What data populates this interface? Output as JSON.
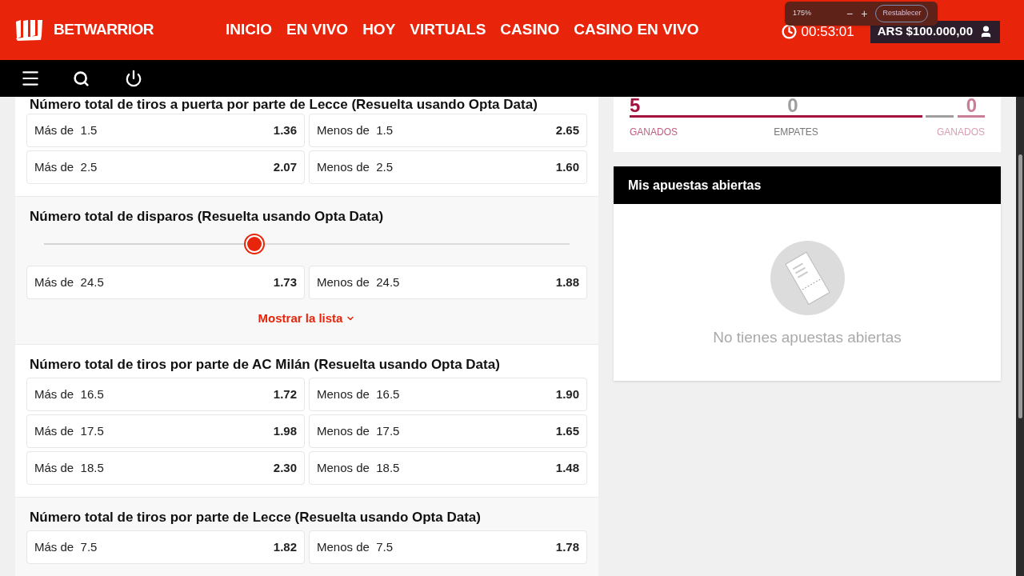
{
  "header": {
    "logo": "BETWARRIOR",
    "nav": [
      "INICIO",
      "EN VIVO",
      "HOY",
      "VIRTUALS",
      "CASINO",
      "CASINO EN VIVO"
    ],
    "timer": "00:53:01",
    "balance": "ARS $100.000,00"
  },
  "zoom_popup": {
    "level": "175%",
    "minus": "−",
    "plus": "+",
    "reset": "Restablecer"
  },
  "markets": [
    {
      "title": "Número total de tiros a puerta por parte de Lecce (Resuelta usando Opta Data)",
      "rows": [
        [
          {
            "label": "Más de",
            "line": "1.5",
            "odd": "1.36"
          },
          {
            "label": "Menos de",
            "line": "1.5",
            "odd": "2.65"
          }
        ],
        [
          {
            "label": "Más de",
            "line": "2.5",
            "odd": "2.07"
          },
          {
            "label": "Menos de",
            "line": "2.5",
            "odd": "1.60"
          }
        ]
      ]
    },
    {
      "title": "Número total de disparos (Resuelta usando Opta Data)",
      "slider": {
        "level": 0.4
      },
      "rows": [
        [
          {
            "label": "Más de",
            "line": "24.5",
            "odd": "1.73"
          },
          {
            "label": "Menos de",
            "line": "24.5",
            "odd": "1.88"
          }
        ]
      ],
      "show_more": "Mostrar la lista"
    },
    {
      "title": "Número total de tiros por parte de AC Milán (Resuelta usando Opta Data)",
      "rows": [
        [
          {
            "label": "Más de",
            "line": "16.5",
            "odd": "1.72"
          },
          {
            "label": "Menos de",
            "line": "16.5",
            "odd": "1.90"
          }
        ],
        [
          {
            "label": "Más de",
            "line": "17.5",
            "odd": "1.98"
          },
          {
            "label": "Menos de",
            "line": "17.5",
            "odd": "1.65"
          }
        ],
        [
          {
            "label": "Más de",
            "line": "18.5",
            "odd": "2.30"
          },
          {
            "label": "Menos de",
            "line": "18.5",
            "odd": "1.48"
          }
        ]
      ]
    },
    {
      "title": "Número total de tiros por parte de Lecce (Resuelta usando Opta Data)",
      "rows": [
        [
          {
            "label": "Más de",
            "line": "7.5",
            "odd": "1.82"
          },
          {
            "label": "Menos de",
            "line": "7.5",
            "odd": "1.78"
          }
        ]
      ]
    }
  ],
  "stats": [
    {
      "value": "5",
      "label": "GANADOS",
      "color": "#a3123f"
    },
    {
      "value": "0",
      "label": "EMPATES",
      "color": "#9e9e9e"
    },
    {
      "value": "0",
      "label": "GANADOS",
      "color": "#c97d98"
    }
  ],
  "open_bets": {
    "title": "Mis apuestas abiertas",
    "empty_text": "No tienes apuestas abiertas"
  }
}
